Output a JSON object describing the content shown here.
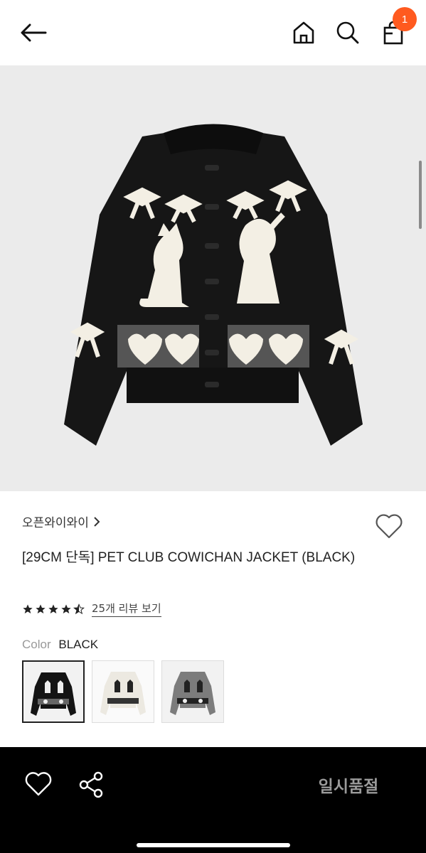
{
  "header": {
    "back_icon": "arrow-left-icon",
    "home_icon": "home-icon",
    "search_icon": "search-icon",
    "bag_icon": "shopping-bag-icon",
    "cart_count": "1",
    "badge_color": "#ff5a1f"
  },
  "product": {
    "image": "black cowichan knit cardigan with cats, bows and hearts",
    "brand": "오픈와이와이",
    "brand_chevron_icon": "chevron-right-icon",
    "wishlist_icon": "heart-outline-icon",
    "title": "[29CM 단독] PET CLUB COWICHAN JACKET (BLACK)",
    "rating": 4.5,
    "review_text": "25개 리뷰 보기",
    "color_label": "Color",
    "color_value": "BLACK",
    "color_options": [
      "BLACK",
      "IVORY",
      "GRAY"
    ],
    "selected_color_index": 0
  },
  "bottom_bar": {
    "wishlist_icon": "heart-outline-icon",
    "share_icon": "share-icon",
    "status": "일시품절"
  }
}
